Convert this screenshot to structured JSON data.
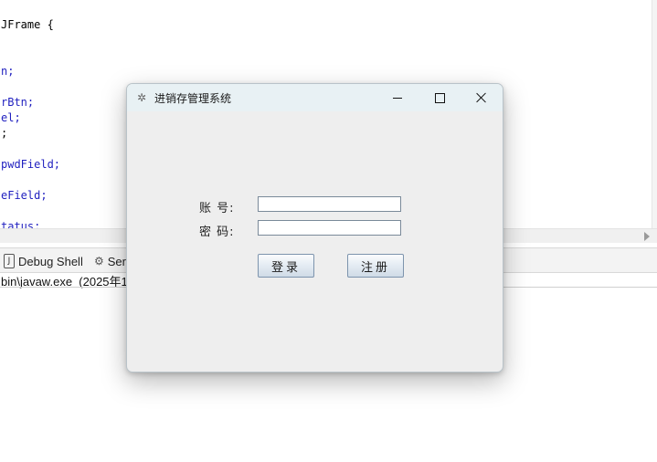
{
  "editor": {
    "lines": [
      {
        "kw": "JFrame {",
        "id": ""
      },
      {
        "kw": "",
        "id": "n;"
      },
      {
        "kw": "",
        "id": "rBtn;"
      },
      {
        "kw": "",
        "id": "el;"
      },
      {
        "kw": ";",
        "id": ""
      },
      {
        "kw": "",
        "id": "pwdField;"
      },
      {
        "kw": "",
        "id": "eField;"
      },
      {
        "kw": "",
        "id": "tatus;"
      }
    ]
  },
  "bottom_panel": {
    "tabs": [
      {
        "label": "Debug Shell",
        "icon": "java-file-icon"
      },
      {
        "label": "Ser",
        "icon": "servers-icon"
      }
    ],
    "console_text": "bin\\javaw.exe  (2025年1"
  },
  "dialog": {
    "title": "进销存管理系统",
    "icon": "java-cup-icon",
    "username_label": "账 号:",
    "password_label": "密 码:",
    "username_value": "",
    "password_value": "",
    "login_button": "登录",
    "register_button": "注册"
  },
  "colors": {
    "titlebar": "#e8f1f4",
    "window_bg": "#eeeeee",
    "code_identifier": "#1f1fbf"
  }
}
